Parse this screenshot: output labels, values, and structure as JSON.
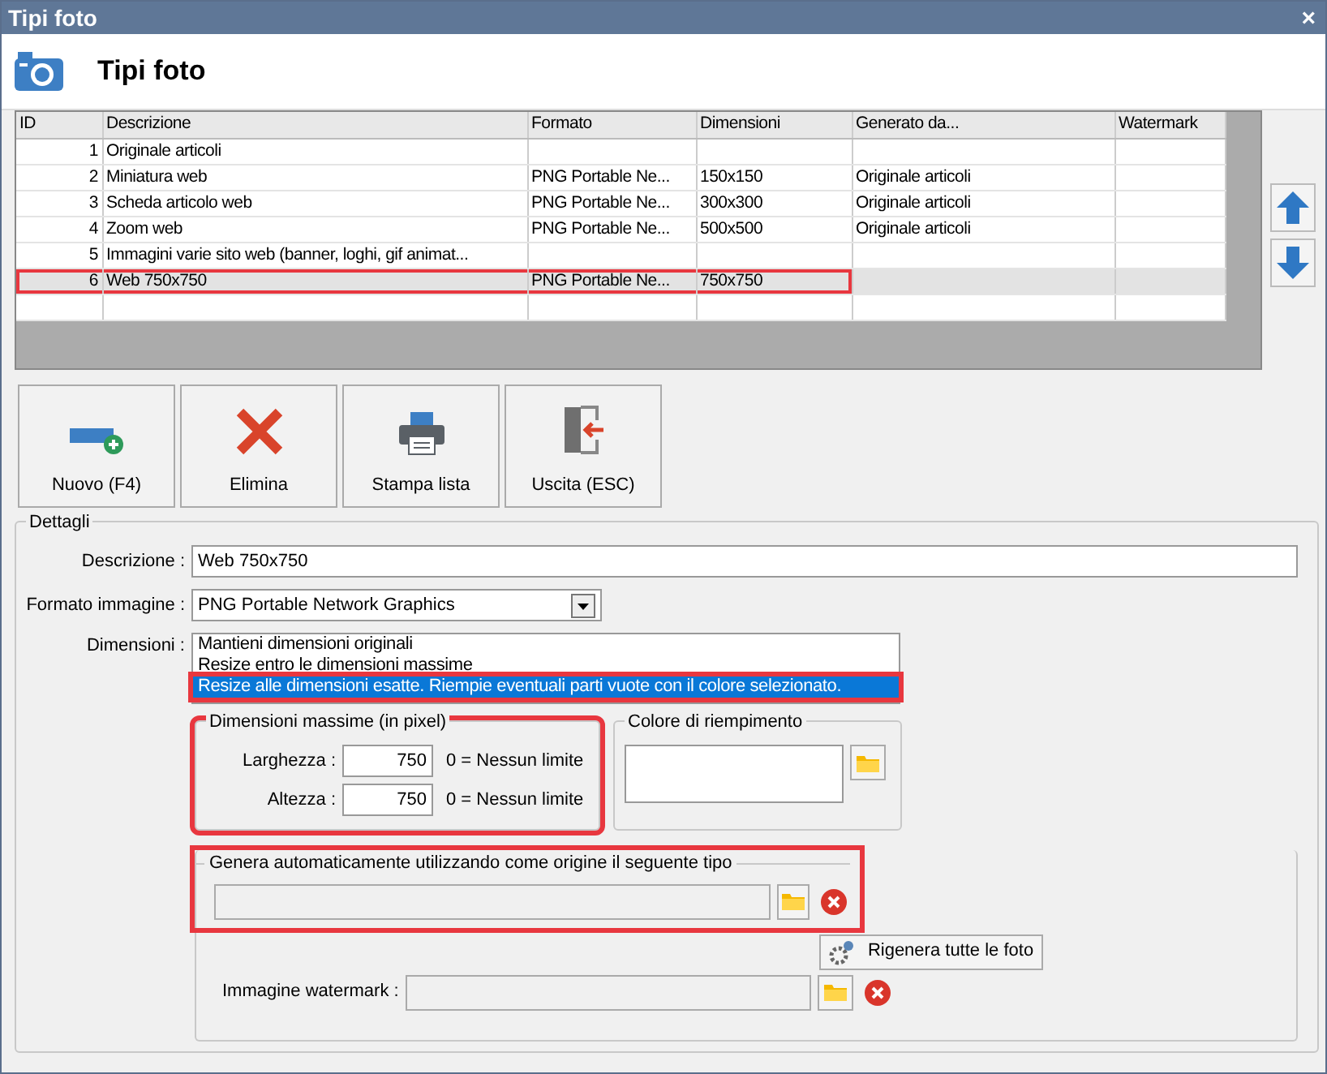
{
  "window": {
    "title": "Tipi foto",
    "close_glyph": "×"
  },
  "header": {
    "title": "Tipi foto"
  },
  "table": {
    "columns": [
      "ID",
      "Descrizione",
      "Formato",
      "Dimensioni",
      "Generato da...",
      "Watermark"
    ],
    "rows": [
      {
        "cells": [
          "1",
          "Originale articoli",
          "",
          "",
          "",
          ""
        ],
        "selected": false,
        "highlighted": false
      },
      {
        "cells": [
          "2",
          "Miniatura web",
          "PNG Portable Ne...",
          "150x150",
          "Originale articoli",
          ""
        ],
        "selected": false,
        "highlighted": false
      },
      {
        "cells": [
          "3",
          "Scheda articolo web",
          "PNG Portable Ne...",
          "300x300",
          "Originale articoli",
          ""
        ],
        "selected": false,
        "highlighted": false
      },
      {
        "cells": [
          "4",
          "Zoom web",
          "PNG Portable Ne...",
          "500x500",
          "Originale articoli",
          ""
        ],
        "selected": false,
        "highlighted": false
      },
      {
        "cells": [
          "5",
          "Immagini varie sito web (banner, loghi, gif animat...",
          "",
          "",
          "",
          ""
        ],
        "selected": false,
        "highlighted": false
      },
      {
        "cells": [
          "6",
          "Web 750x750",
          "PNG Portable Ne...",
          "750x750",
          "",
          ""
        ],
        "selected": true,
        "highlighted": true
      }
    ]
  },
  "side_buttons": [
    {
      "kind": "up"
    },
    {
      "kind": "down"
    }
  ],
  "toolbar": [
    {
      "label": "Nuovo (F4)",
      "kind": "new"
    },
    {
      "label": "Elimina",
      "kind": "delete"
    },
    {
      "label": "Stampa lista",
      "kind": "print"
    },
    {
      "label": "Uscita (ESC)",
      "kind": "exit"
    }
  ],
  "details": {
    "title": "Dettagli",
    "description": {
      "label": "Descrizione :",
      "value": "Web 750x750"
    },
    "format": {
      "label": "Formato immagine :",
      "value": "PNG Portable Network Graphics"
    },
    "dimensions": {
      "label": "Dimensioni :",
      "options": [
        {
          "text": "Mantieni dimensioni originali",
          "selected": false,
          "highlighted": false
        },
        {
          "text": "Resize entro le dimensioni massime",
          "selected": false,
          "highlighted": false
        },
        {
          "text": "Resize alle dimensioni esatte. Riempie eventuali parti vuote con il colore selezionato.",
          "selected": true,
          "highlighted": true
        }
      ]
    },
    "max_size": {
      "title": "Dimensioni massime (in pixel)",
      "highlighted": true,
      "fields": [
        {
          "label": "Larghezza :",
          "value": "750",
          "hint": "0 = Nessun limite"
        },
        {
          "label": "Altezza :",
          "value": "750",
          "hint": "0 = Nessun limite"
        }
      ]
    },
    "fill_color": {
      "title": "Colore di riempimento"
    },
    "source": {
      "title": "Genera automaticamente utilizzando come origine il seguente tipo",
      "highlighted": true
    },
    "regenerate": {
      "label": "Rigenera tutte le foto"
    },
    "watermark": {
      "label": "Immagine watermark :"
    }
  }
}
